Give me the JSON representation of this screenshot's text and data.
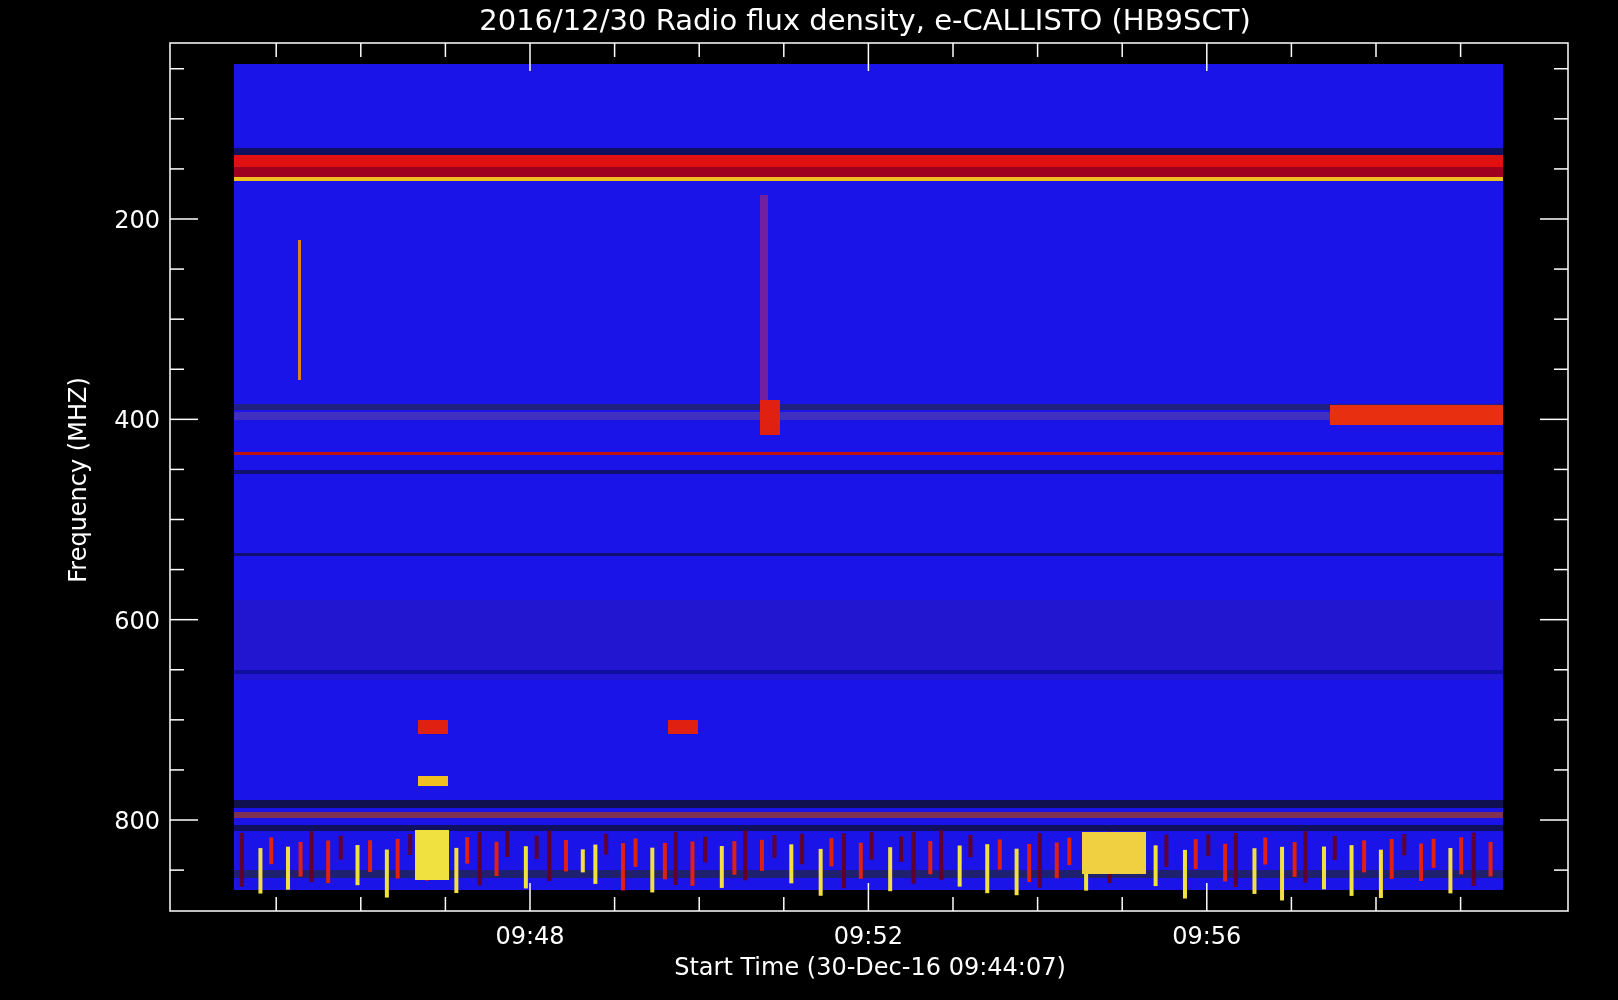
{
  "title": "2016/12/30  Radio flux density, e-CALLISTO (HB9SCT)",
  "ylabel": "Frequency (MHZ)",
  "xlabel": "Start Time (30-Dec-16 09:44:07)",
  "y_ticks": [
    "200",
    "400",
    "600",
    "800"
  ],
  "x_ticks": [
    "09:48",
    "09:52",
    "09:56"
  ]
}
